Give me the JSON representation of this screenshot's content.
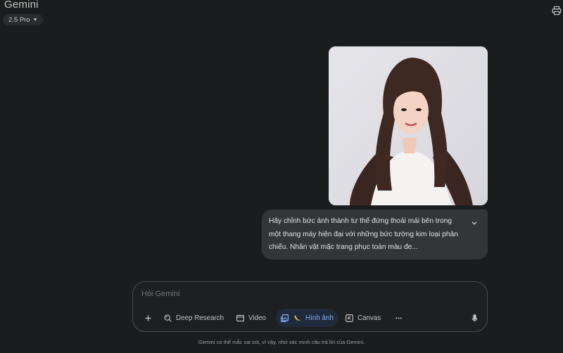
{
  "header": {
    "title": "Gemini",
    "model_label": "2.5 Pro"
  },
  "conversation": {
    "prompt_text": "Hãy chỉnh bức ảnh thành tư thế đứng thoải mái bên trong một thang máy hiện đại với những bức tường kim loại phản chiếu. Nhân vật mặc trang phục toàn màu đe..."
  },
  "composer": {
    "placeholder": "Hỏi Gemini",
    "tools": {
      "deep_research": "Deep Research",
      "video": "Video",
      "image": "Hình ảnh",
      "canvas": "Canvas"
    }
  },
  "footer": {
    "disclaimer": "Gemini có thể mắc sai sót, vì vậy, nhớ xác minh câu trả lời của Gemini."
  },
  "colors": {
    "background": "#1b1c1d",
    "bubble": "#333537",
    "accent": "#8ab4f8"
  }
}
